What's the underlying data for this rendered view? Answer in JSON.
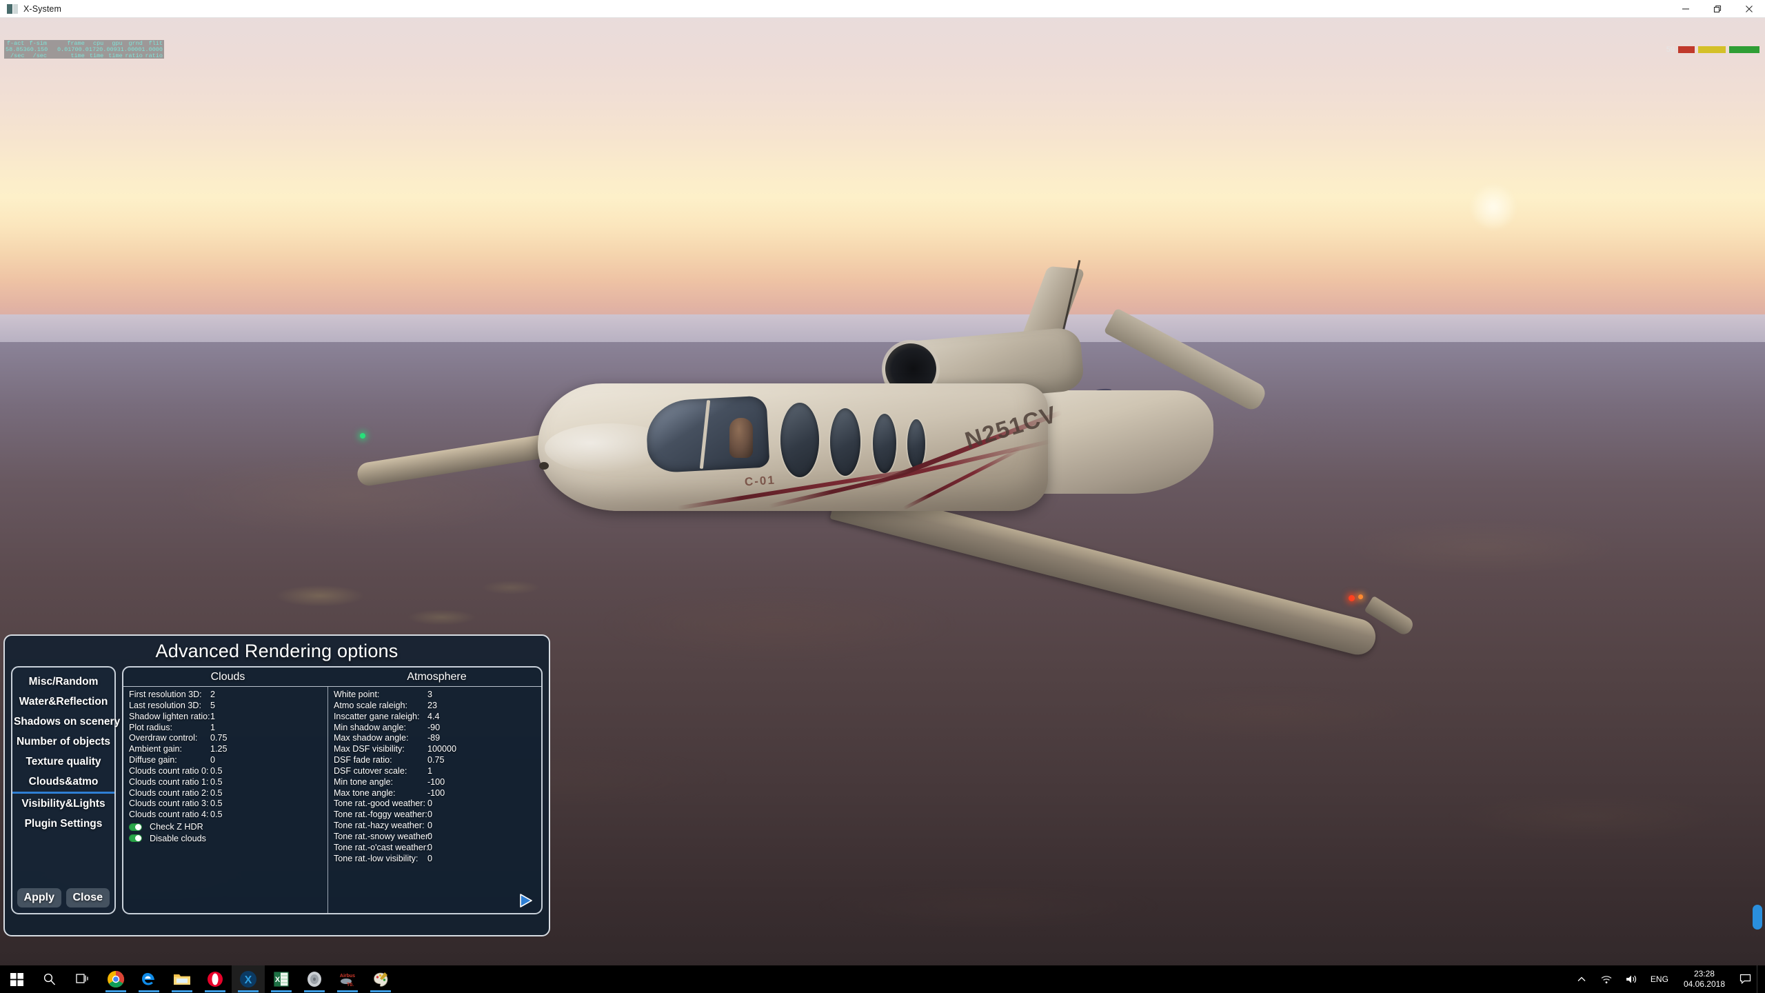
{
  "window": {
    "title": "X-System",
    "icon": "app-icon",
    "controls": {
      "minimize": "minimize-icon",
      "restore": "restore-icon",
      "close": "close-icon"
    }
  },
  "fps_overlay": {
    "headers": [
      "f-act",
      "f-sim",
      "frame",
      "cpu",
      "gpu",
      "grnd",
      "flit"
    ],
    "values": [
      "58.853",
      "60.150",
      "0.0170",
      "0.0172",
      "0.0093",
      "1.0000",
      "1.0000"
    ],
    "units": [
      "/sec",
      "/sec",
      "time",
      "time",
      "time",
      "ratio",
      "ratio"
    ]
  },
  "fps_bar": {
    "value": "59",
    "colors": [
      "#c0392b",
      "#d4c028",
      "#2f9e35"
    ]
  },
  "scene": {
    "aircraft_registration": "N251CV",
    "aircraft_marking": "C-01"
  },
  "dialog": {
    "title": "Advanced Rendering options",
    "nav": {
      "items": [
        {
          "label": "Misc/Random",
          "selected": false
        },
        {
          "label": "Water&Reflection",
          "selected": false
        },
        {
          "label": "Shadows on scenery",
          "selected": false
        },
        {
          "label": "Number of objects",
          "selected": false
        },
        {
          "label": "Texture quality",
          "selected": false
        },
        {
          "label": "Clouds&atmo",
          "selected": true
        },
        {
          "label": "Visibility&Lights",
          "selected": false
        },
        {
          "label": "Plugin Settings",
          "selected": false
        }
      ],
      "apply_label": "Apply",
      "close_label": "Close"
    },
    "columns": {
      "clouds": {
        "header": "Clouds",
        "settings": [
          {
            "label": "First resolution 3D:",
            "value": "2"
          },
          {
            "label": "Last resolution 3D:",
            "value": "5"
          },
          {
            "label": "Shadow lighten ratio:",
            "value": "1"
          },
          {
            "label": "Plot radius:",
            "value": "1"
          },
          {
            "label": "Overdraw control:",
            "value": "0.75"
          },
          {
            "label": "Ambient gain:",
            "value": "1.25"
          },
          {
            "label": "Diffuse gain:",
            "value": "0"
          },
          {
            "label": "Clouds count ratio 0:",
            "value": "0.5"
          },
          {
            "label": "Clouds count ratio 1:",
            "value": "0.5"
          },
          {
            "label": "Clouds count ratio 2:",
            "value": "0.5"
          },
          {
            "label": "Clouds count ratio 3:",
            "value": "0.5"
          },
          {
            "label": "Clouds count ratio 4:",
            "value": "0.5"
          }
        ],
        "toggles": [
          {
            "label": "Check Z HDR",
            "on": true
          },
          {
            "label": "Disable clouds",
            "on": true
          }
        ]
      },
      "atmosphere": {
        "header": "Atmosphere",
        "settings": [
          {
            "label": "White point:",
            "value": "3"
          },
          {
            "label": "Atmo scale raleigh:",
            "value": "23"
          },
          {
            "label": "Inscatter gane raleigh:",
            "value": "4.4"
          },
          {
            "label": "Min shadow angle:",
            "value": "-90"
          },
          {
            "label": "Max shadow angle:",
            "value": "-89"
          },
          {
            "label": "Max DSF visibility:",
            "value": "100000"
          },
          {
            "label": "DSF fade ratio:",
            "value": "0.75"
          },
          {
            "label": "DSF cutover scale:",
            "value": "1"
          },
          {
            "label": "Min tone angle:",
            "value": "-100"
          },
          {
            "label": "Max tone angle:",
            "value": "-100"
          },
          {
            "label": "Tone rat.-good weather:",
            "value": "0"
          },
          {
            "label": "Tone rat.-foggy weather:",
            "value": "0"
          },
          {
            "label": "Tone rat.-hazy weather:",
            "value": "0"
          },
          {
            "label": "Tone rat.-snowy weather:",
            "value": "0"
          },
          {
            "label": "Tone rat.-o'cast weather:",
            "value": "0"
          },
          {
            "label": "Tone rat.-low visibility:",
            "value": "0"
          }
        ]
      }
    },
    "next_page_icon": "play-triangle-icon"
  },
  "taskbar": {
    "items": [
      {
        "name": "start-button",
        "icon": "windows-logo-icon"
      },
      {
        "name": "search-button",
        "icon": "search-icon"
      },
      {
        "name": "task-view-button",
        "icon": "task-view-icon"
      },
      {
        "name": "taskbar-chrome",
        "icon": "chrome-icon"
      },
      {
        "name": "taskbar-edge",
        "icon": "edge-icon"
      },
      {
        "name": "taskbar-file-explorer",
        "icon": "folder-icon"
      },
      {
        "name": "taskbar-opera",
        "icon": "opera-icon"
      },
      {
        "name": "taskbar-xplane",
        "icon": "xplane-icon"
      },
      {
        "name": "taskbar-excel",
        "icon": "excel-icon"
      },
      {
        "name": "taskbar-media",
        "icon": "disc-icon"
      },
      {
        "name": "taskbar-airbus",
        "icon": "airbus-icon"
      },
      {
        "name": "taskbar-paint",
        "icon": "paint-palette-icon"
      }
    ],
    "tray": {
      "overflow": "chevron-up-icon",
      "network": "wifi-icon",
      "volume": "speaker-icon",
      "language": "ENG",
      "time": "23:28",
      "date": "04.06.2018",
      "notifications": "notification-icon"
    }
  }
}
